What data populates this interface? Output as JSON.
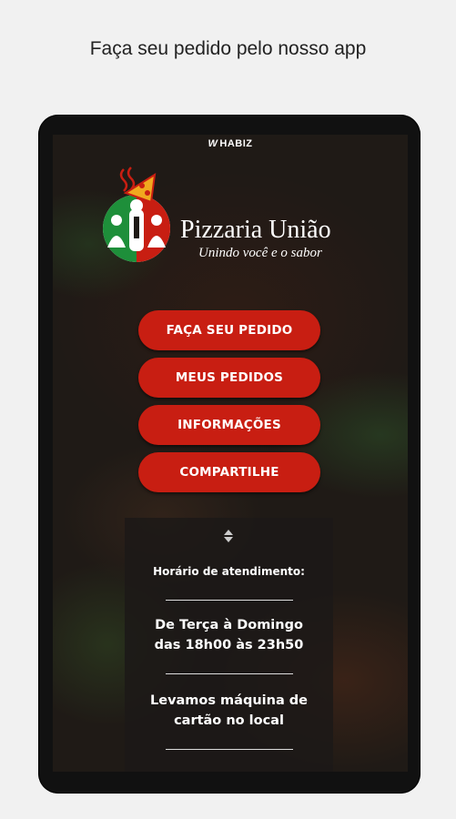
{
  "caption": "Faça seu pedido pelo nosso app",
  "brand": {
    "mark": "W",
    "name": "HABIZ"
  },
  "logo": {
    "title": "Pizzaria União",
    "subtitle": "Unindo você e o sabor"
  },
  "menu": {
    "order": "FAÇA SEU PEDIDO",
    "my_orders": "MEUS PEDIDOS",
    "info": "INFORMAÇÕES",
    "share": "COMPARTILHE"
  },
  "info_panel": {
    "heading": "Horário de atendimento:",
    "hours_line1": "De Terça à Domingo",
    "hours_line2": "das 18h00 às 23h50",
    "card_line1": "Levamos máquina de",
    "card_line2": "cartão no local"
  },
  "colors": {
    "button": "#c81e12",
    "logo_green": "#1e8f3a",
    "logo_red": "#c81e12"
  }
}
